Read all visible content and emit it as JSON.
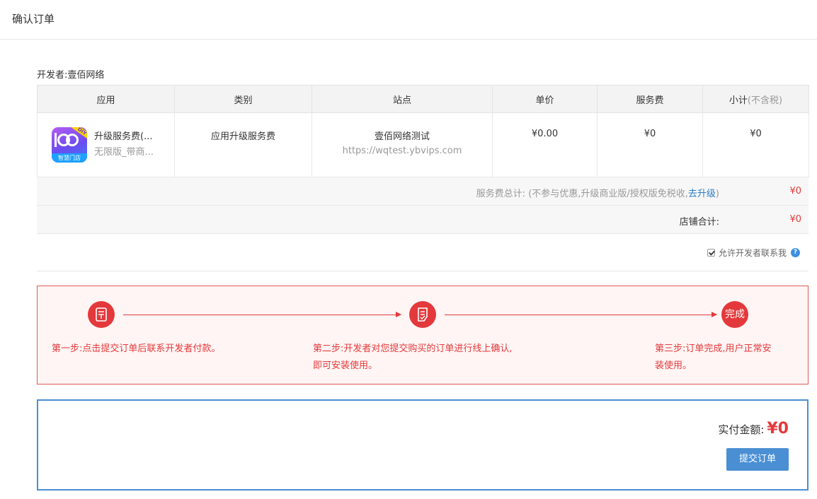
{
  "page": {
    "title": "确认订单"
  },
  "developer": {
    "label": "开发者:壹佰网络"
  },
  "table": {
    "columns": [
      "应用",
      "类别",
      "站点",
      "单价",
      "服务费",
      "小计"
    ],
    "subtotal_note": "(不含税)",
    "rows": [
      {
        "app_name": "升级服务费(...",
        "app_sub": "无限版_带商...",
        "category": "应用升级服务费",
        "site_name": "壹佰网络测试",
        "site_url": "https://wqtest.ybvips.com",
        "unit_price": "¥0.00",
        "service_fee": "¥0",
        "subtotal": "¥0"
      }
    ]
  },
  "app_logo": {
    "badge": "DIY",
    "store_label": "智慧门店"
  },
  "summary": {
    "service_total_label": "服务费总计:",
    "service_total_note_pre": "(不参与优惠,升级商业版/授权版免税收,",
    "upgrade_link": "去升级",
    "service_total_note_post": ")",
    "service_total_value": "¥0",
    "store_total_label": "店铺合计:",
    "store_total_value": "¥0"
  },
  "contact": {
    "label": "允许开发者联系我",
    "checked": true,
    "help": "?"
  },
  "flow": {
    "steps": [
      {
        "icon": "document-icon",
        "text_line1": "第一步:点击提交订单后联系开发者付款。",
        "text_line2": ""
      },
      {
        "icon": "document-check-icon",
        "text_line1": "第二步:开发者对您提交购买的订单进行线上确认,",
        "text_line2": "即可安装使用。"
      },
      {
        "icon_text": "完成",
        "text_line1": "第三步:订单完成,用户正常安",
        "text_line2": "装使用。"
      }
    ],
    "accent": "#e4393c"
  },
  "payment": {
    "label": "实付金额:",
    "amount": "¥0",
    "submit_label": "提交订单",
    "accent": "#4a8fd3"
  }
}
